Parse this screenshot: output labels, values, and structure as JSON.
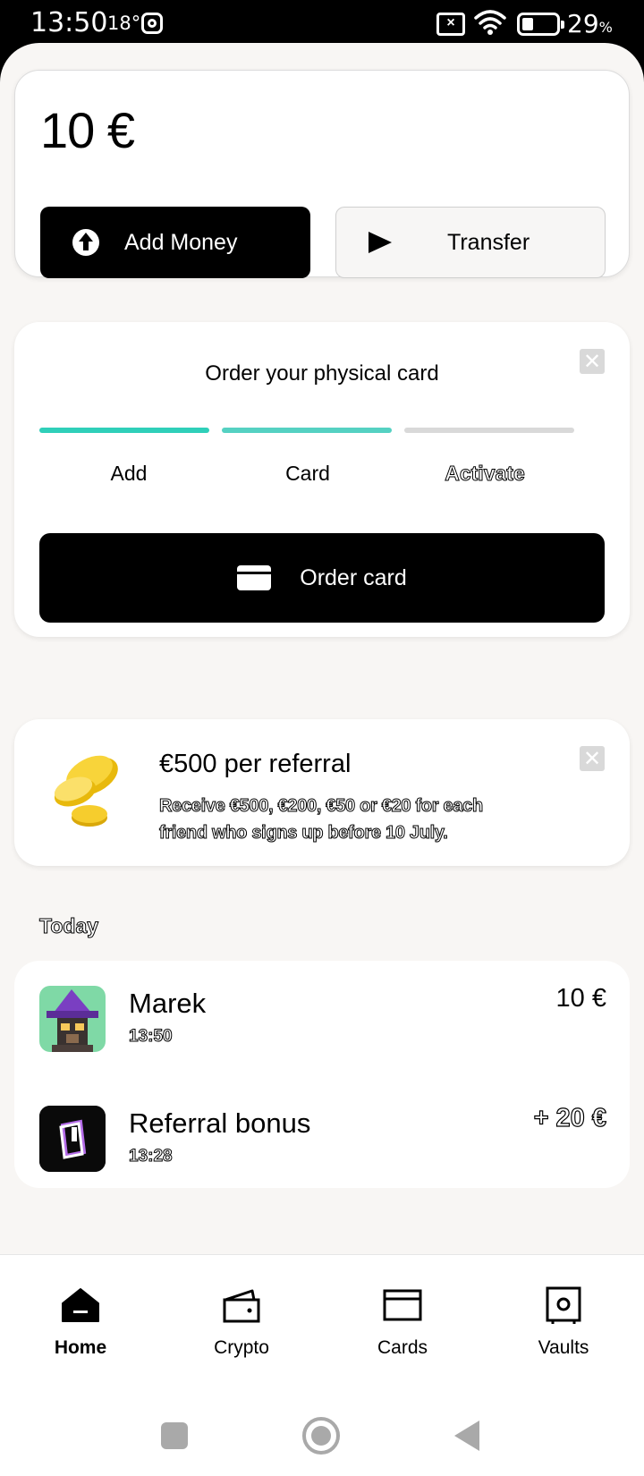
{
  "status_bar": {
    "time": "13:50",
    "temperature": "18°",
    "battery_percent": "29",
    "battery_symbol": "%",
    "icons": [
      "instagram-icon",
      "no-sim-icon",
      "wifi-icon",
      "battery-icon"
    ]
  },
  "balance_card": {
    "balance": "10 €",
    "add_money_label": "Add Money",
    "transfer_label": "Transfer"
  },
  "order_card": {
    "title": "Order your physical card",
    "close_symbol": "✕",
    "steps": [
      {
        "label": "Add",
        "complete": true
      },
      {
        "label": "Card",
        "complete": true
      },
      {
        "label": "Activate",
        "complete": false
      }
    ],
    "order_button_label": "Order card",
    "accent_color": "#2fcfb9",
    "accent_color_secondary": "#55d1c2",
    "inactive_color": "#d9d9d9"
  },
  "referral_card": {
    "title": "€500 per referral",
    "description": "Receive €500, €200, €50 or €20 for each friend who signs up before 10 July.",
    "close_symbol": "✕"
  },
  "transactions": {
    "section_label": "Today",
    "items": [
      {
        "name": "Marek",
        "time": "13:50",
        "amount": "10 €"
      },
      {
        "name": "Referral bonus",
        "time": "13:28",
        "amount": "+ 20 €"
      }
    ]
  },
  "bottom_nav": {
    "items": [
      {
        "label": "Home",
        "icon": "home-icon",
        "active": true
      },
      {
        "label": "Crypto",
        "icon": "wallet-icon",
        "active": false
      },
      {
        "label": "Cards",
        "icon": "card-icon",
        "active": false
      },
      {
        "label": "Vaults",
        "icon": "vault-icon",
        "active": false
      }
    ]
  }
}
